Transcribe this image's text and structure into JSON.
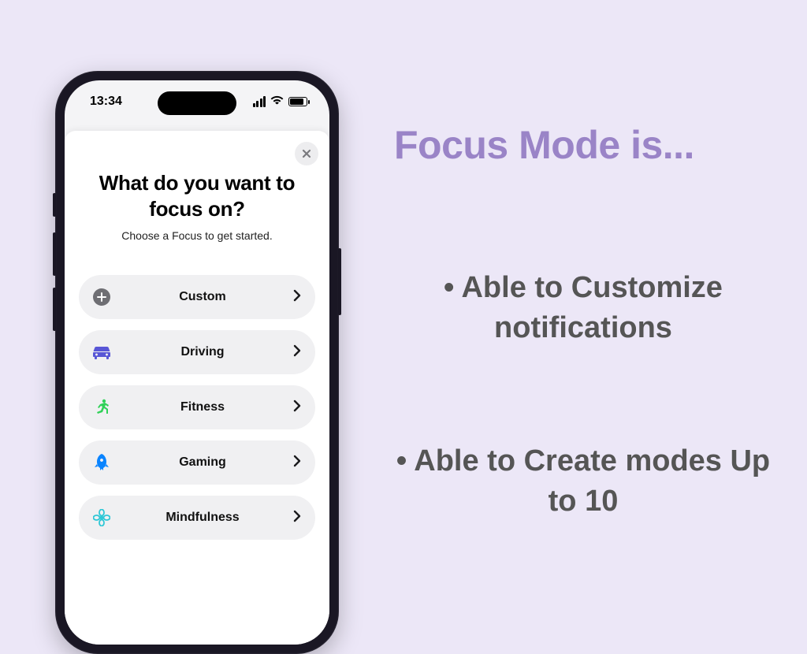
{
  "status": {
    "time": "13:34"
  },
  "sheet": {
    "title": "What do you want to focus on?",
    "subtitle": "Choose a Focus to get started."
  },
  "focus_items": [
    {
      "label": "Custom",
      "icon": "plus",
      "color": "#6e6e73"
    },
    {
      "label": "Driving",
      "icon": "car",
      "color": "#5856d6"
    },
    {
      "label": "Fitness",
      "icon": "run",
      "color": "#30d158"
    },
    {
      "label": "Gaming",
      "icon": "rocket",
      "color": "#0a84ff"
    },
    {
      "label": "Mindfulness",
      "icon": "flower",
      "color": "#2ec7d6"
    }
  ],
  "headline": "Focus Mode is...",
  "features": [
    "• Able to Customize notifications",
    "• Able to Create modes Up to 10"
  ]
}
